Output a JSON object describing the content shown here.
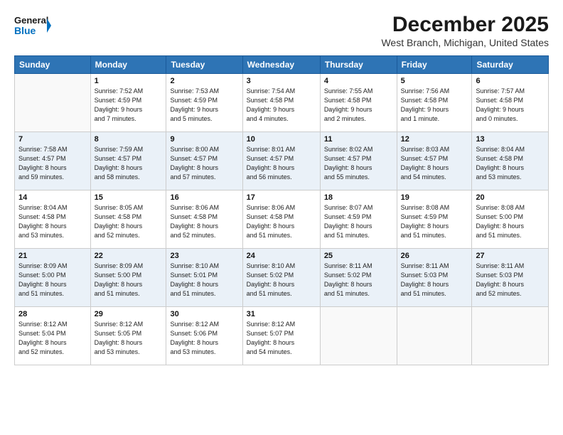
{
  "header": {
    "logo_line1": "General",
    "logo_line2": "Blue",
    "title": "December 2025",
    "subtitle": "West Branch, Michigan, United States"
  },
  "columns": [
    "Sunday",
    "Monday",
    "Tuesday",
    "Wednesday",
    "Thursday",
    "Friday",
    "Saturday"
  ],
  "weeks": [
    [
      {
        "day": "",
        "info": ""
      },
      {
        "day": "1",
        "info": "Sunrise: 7:52 AM\nSunset: 4:59 PM\nDaylight: 9 hours\nand 7 minutes."
      },
      {
        "day": "2",
        "info": "Sunrise: 7:53 AM\nSunset: 4:59 PM\nDaylight: 9 hours\nand 5 minutes."
      },
      {
        "day": "3",
        "info": "Sunrise: 7:54 AM\nSunset: 4:58 PM\nDaylight: 9 hours\nand 4 minutes."
      },
      {
        "day": "4",
        "info": "Sunrise: 7:55 AM\nSunset: 4:58 PM\nDaylight: 9 hours\nand 2 minutes."
      },
      {
        "day": "5",
        "info": "Sunrise: 7:56 AM\nSunset: 4:58 PM\nDaylight: 9 hours\nand 1 minute."
      },
      {
        "day": "6",
        "info": "Sunrise: 7:57 AM\nSunset: 4:58 PM\nDaylight: 9 hours\nand 0 minutes."
      }
    ],
    [
      {
        "day": "7",
        "info": "Sunrise: 7:58 AM\nSunset: 4:57 PM\nDaylight: 8 hours\nand 59 minutes."
      },
      {
        "day": "8",
        "info": "Sunrise: 7:59 AM\nSunset: 4:57 PM\nDaylight: 8 hours\nand 58 minutes."
      },
      {
        "day": "9",
        "info": "Sunrise: 8:00 AM\nSunset: 4:57 PM\nDaylight: 8 hours\nand 57 minutes."
      },
      {
        "day": "10",
        "info": "Sunrise: 8:01 AM\nSunset: 4:57 PM\nDaylight: 8 hours\nand 56 minutes."
      },
      {
        "day": "11",
        "info": "Sunrise: 8:02 AM\nSunset: 4:57 PM\nDaylight: 8 hours\nand 55 minutes."
      },
      {
        "day": "12",
        "info": "Sunrise: 8:03 AM\nSunset: 4:57 PM\nDaylight: 8 hours\nand 54 minutes."
      },
      {
        "day": "13",
        "info": "Sunrise: 8:04 AM\nSunset: 4:58 PM\nDaylight: 8 hours\nand 53 minutes."
      }
    ],
    [
      {
        "day": "14",
        "info": "Sunrise: 8:04 AM\nSunset: 4:58 PM\nDaylight: 8 hours\nand 53 minutes."
      },
      {
        "day": "15",
        "info": "Sunrise: 8:05 AM\nSunset: 4:58 PM\nDaylight: 8 hours\nand 52 minutes."
      },
      {
        "day": "16",
        "info": "Sunrise: 8:06 AM\nSunset: 4:58 PM\nDaylight: 8 hours\nand 52 minutes."
      },
      {
        "day": "17",
        "info": "Sunrise: 8:06 AM\nSunset: 4:58 PM\nDaylight: 8 hours\nand 51 minutes."
      },
      {
        "day": "18",
        "info": "Sunrise: 8:07 AM\nSunset: 4:59 PM\nDaylight: 8 hours\nand 51 minutes."
      },
      {
        "day": "19",
        "info": "Sunrise: 8:08 AM\nSunset: 4:59 PM\nDaylight: 8 hours\nand 51 minutes."
      },
      {
        "day": "20",
        "info": "Sunrise: 8:08 AM\nSunset: 5:00 PM\nDaylight: 8 hours\nand 51 minutes."
      }
    ],
    [
      {
        "day": "21",
        "info": "Sunrise: 8:09 AM\nSunset: 5:00 PM\nDaylight: 8 hours\nand 51 minutes."
      },
      {
        "day": "22",
        "info": "Sunrise: 8:09 AM\nSunset: 5:00 PM\nDaylight: 8 hours\nand 51 minutes."
      },
      {
        "day": "23",
        "info": "Sunrise: 8:10 AM\nSunset: 5:01 PM\nDaylight: 8 hours\nand 51 minutes."
      },
      {
        "day": "24",
        "info": "Sunrise: 8:10 AM\nSunset: 5:02 PM\nDaylight: 8 hours\nand 51 minutes."
      },
      {
        "day": "25",
        "info": "Sunrise: 8:11 AM\nSunset: 5:02 PM\nDaylight: 8 hours\nand 51 minutes."
      },
      {
        "day": "26",
        "info": "Sunrise: 8:11 AM\nSunset: 5:03 PM\nDaylight: 8 hours\nand 51 minutes."
      },
      {
        "day": "27",
        "info": "Sunrise: 8:11 AM\nSunset: 5:03 PM\nDaylight: 8 hours\nand 52 minutes."
      }
    ],
    [
      {
        "day": "28",
        "info": "Sunrise: 8:12 AM\nSunset: 5:04 PM\nDaylight: 8 hours\nand 52 minutes."
      },
      {
        "day": "29",
        "info": "Sunrise: 8:12 AM\nSunset: 5:05 PM\nDaylight: 8 hours\nand 53 minutes."
      },
      {
        "day": "30",
        "info": "Sunrise: 8:12 AM\nSunset: 5:06 PM\nDaylight: 8 hours\nand 53 minutes."
      },
      {
        "day": "31",
        "info": "Sunrise: 8:12 AM\nSunset: 5:07 PM\nDaylight: 8 hours\nand 54 minutes."
      },
      {
        "day": "",
        "info": ""
      },
      {
        "day": "",
        "info": ""
      },
      {
        "day": "",
        "info": ""
      }
    ]
  ]
}
